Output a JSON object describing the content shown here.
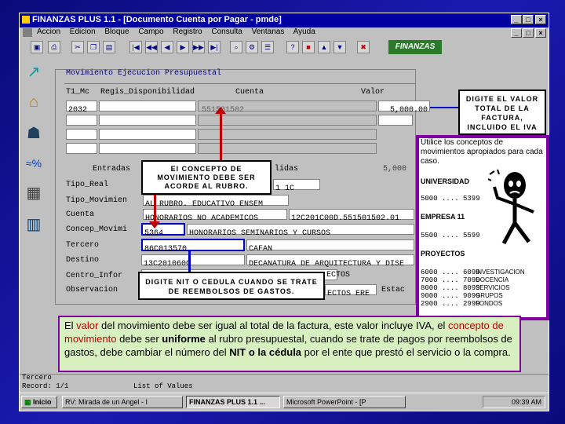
{
  "window": {
    "title": "FINANZAS PLUS 1.1 - [Documento Cuenta por Pagar - pmde]",
    "menu": [
      "Accion",
      "Edicion",
      "Bloque",
      "Campo",
      "Registro",
      "Consulta",
      "Ventanas",
      "Ayuda"
    ]
  },
  "logo": "FINANZAS",
  "form": {
    "section_title": "Movimiento Ejecucion Presupuestal",
    "headers": [
      "T1_Mc",
      "Regis_Disponibilidad",
      "Cuenta",
      "Valor"
    ],
    "row1": {
      "t1": "2032",
      "cuenta": "551501502",
      "valor": "5,000.00"
    },
    "entradas_label": "Entradas",
    "salidas_label": "lidas",
    "salidas_value": "5,000",
    "labels": [
      "Tipo_Real",
      "Tipo_Movimien",
      "Cuenta",
      "Concep_Movimi",
      "Tercero",
      "Destino",
      "Centro_Infor",
      "Observacion"
    ],
    "tipo_mov_value": "AL RUBRO. EDUCATIVO ENSEM",
    "cuenta_desc": "HONORARIOS NO ACADEMICOS",
    "cuenta_code": "12C201C00D.551501502.01",
    "concepto_code": "5364",
    "concepto_desc": "HONORARIOS SEMINARIOS Y CURSOS",
    "tercero_code": "86C013570",
    "tercero_desc": "CAFAN",
    "destino_code": "13C201060C",
    "destino_desc": "DECANATURA DE ARQUITECTURA Y DISE",
    "centro_desc": "ECTOS",
    "obs_desc": "ECTOS ERE",
    "estado_label": "Estac",
    "partial_value": "1 1C"
  },
  "notes": {
    "concepto": "El CONCEPTO DE MOVIMIENTO DEBE SER ACORDE AL RUBRO.",
    "valor": "DIGITE EL VALOR TOTAL DE LA FACTURA, INCLUIDO EL IVA",
    "nit": "DIGITE NIT O CEDULA CUANDO SE TRATE DE REEMBOLSOS DE GASTOS."
  },
  "conceptos_panel": {
    "intro": "Utilice los conceptos de movimientos apropiados para cada caso.",
    "universidad_label": "UNIVERSIDAD",
    "universidad_range": "5000 .... 5399",
    "empresa_label": "EMPRESA 11",
    "empresa_range": "5500 .... 5599",
    "proyectos_label": "PROYECTOS",
    "proyectos": [
      {
        "range": "6000 .... 6099",
        "name": "INVESTIGACION"
      },
      {
        "range": "7000 .... 7099",
        "name": "DOCENCIA"
      },
      {
        "range": "8000 .... 8099",
        "name": "SERVICIOS"
      },
      {
        "range": "9000 .... 9099",
        "name": "GRUPOS"
      },
      {
        "range": "2900 .... 2999",
        "name": "FONDOS"
      }
    ]
  },
  "info_box": {
    "p1": "El ",
    "p2": "valor",
    "p3": " del movimiento debe ser igual al total de la factura, este valor incluye IVA, el ",
    "p4": "concepto de movimiento",
    "p5": " debe ser ",
    "p6": "uniforme",
    "p7": " al rubro presupuestal, cuando se trate de pagos por reembolsos de gastos, debe cambiar el número del ",
    "p8": "NIT o la cédula",
    "p9": " por el ente que prestó el servicio o la compra."
  },
  "status": {
    "tercero": "Tercero",
    "record": "Record: 1/1",
    "lov": "List of Values"
  },
  "taskbar": {
    "start": "Inicio",
    "tasks": [
      "RV: Mirada de un Angel - I",
      "FINANZAS PLUS 1.1 ...",
      "Microsoft PowerPoint - [P"
    ],
    "clock": "09:39 AM"
  },
  "colors": {
    "accent_red": "#c00000",
    "note_blue": "#0000c0",
    "panel_purple": "#8000a0",
    "info_bg": "#d8f0c0"
  }
}
